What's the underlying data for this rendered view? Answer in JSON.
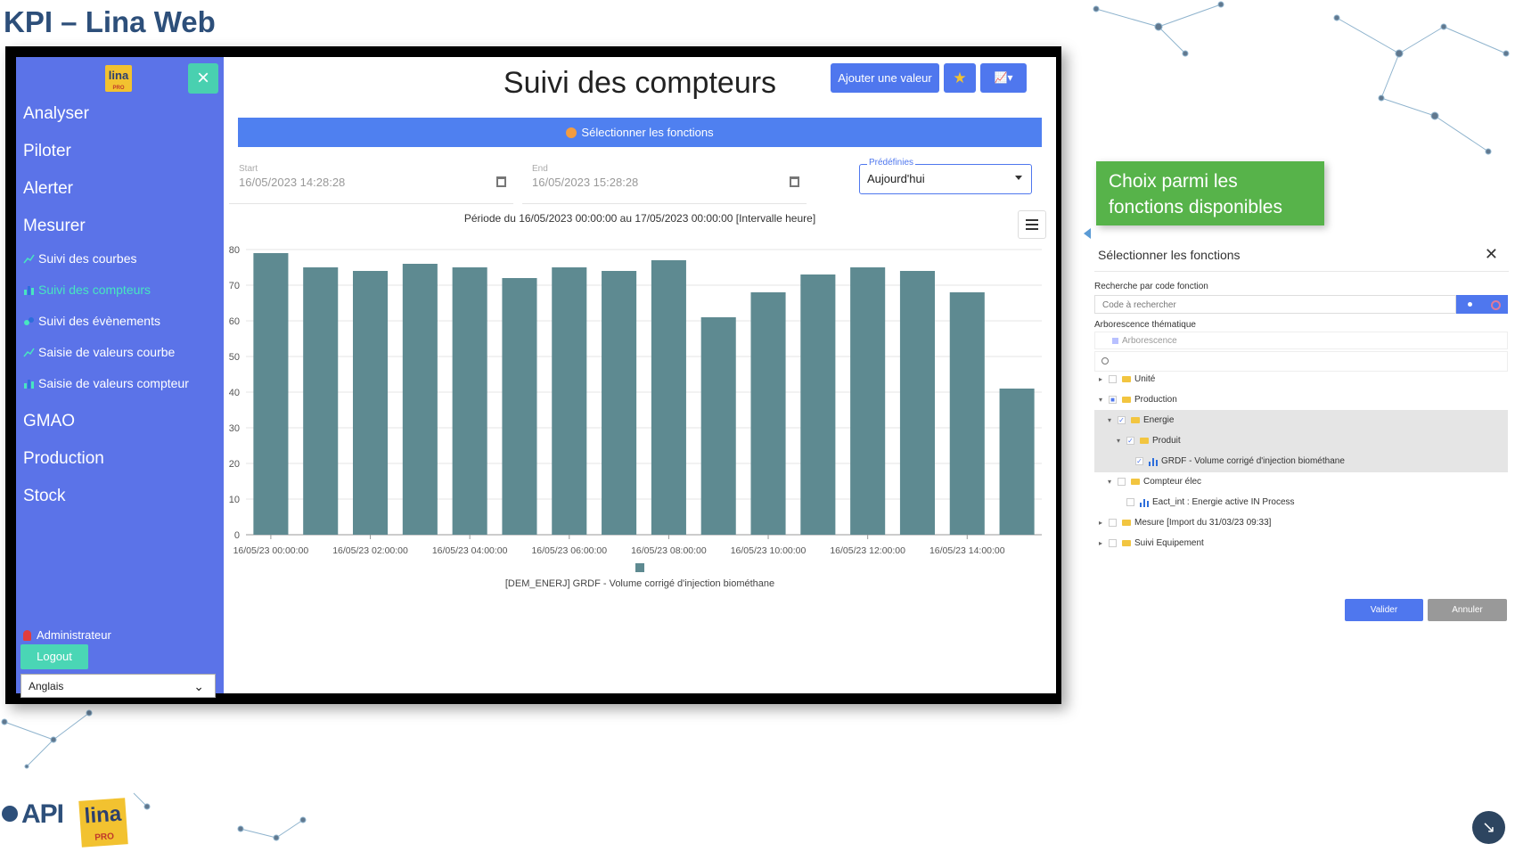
{
  "slide": {
    "title": "KPI – Lina Web"
  },
  "sidebar": {
    "logo_text": "lina",
    "logo_sub": "PRO",
    "close_icon": "×",
    "top_items": [
      {
        "label": "Analyser"
      },
      {
        "label": "Piloter"
      },
      {
        "label": "Alerter"
      },
      {
        "label": "Mesurer"
      }
    ],
    "sub_items": [
      {
        "label": "Suivi des courbes",
        "icon": "line-chart-icon"
      },
      {
        "label": "Suivi des compteurs",
        "icon": "bar-chart-icon",
        "active": true
      },
      {
        "label": "Suivi des évènements",
        "icon": "events-icon"
      },
      {
        "label": "Saisie de valeurs courbe",
        "icon": "line-chart-icon"
      },
      {
        "label": "Saisie de valeurs compteur",
        "icon": "bar-chart-icon"
      }
    ],
    "bottom_items": [
      {
        "label": "GMAO"
      },
      {
        "label": "Production"
      },
      {
        "label": "Stock"
      }
    ],
    "user": "Administrateur",
    "logout_label": "Logout",
    "language": "Anglais"
  },
  "main": {
    "title": "Suivi des compteurs",
    "add_value_label": "Ajouter une valeur",
    "select_functions_label": "Sélectionner les fonctions",
    "start": {
      "label": "Start",
      "value": "16/05/2023 14:28:28"
    },
    "end": {
      "label": "End",
      "value": "16/05/2023 15:28:28"
    },
    "predefined": {
      "label": "Prédéfinies",
      "value": "Aujourd'hui"
    },
    "period": "Période du 16/05/2023 00:00:00 au 17/05/2023 00:00:00  [Intervalle heure]"
  },
  "chart_data": {
    "type": "bar",
    "categories": [
      "16/05/23 00:00:00",
      "",
      "16/05/23 02:00:00",
      "",
      "16/05/23 04:00:00",
      "",
      "16/05/23 06:00:00",
      "",
      "16/05/23 08:00:00",
      "",
      "16/05/23 10:00:00",
      "",
      "16/05/23 12:00:00",
      "",
      "16/05/23 14:00:00",
      ""
    ],
    "x_tick_labels": [
      "16/05/23 00:00:00",
      "16/05/23 02:00:00",
      "16/05/23 04:00:00",
      "16/05/23 06:00:00",
      "16/05/23 08:00:00",
      "16/05/23 10:00:00",
      "16/05/23 12:00:00",
      "16/05/23 14:00:00"
    ],
    "series": [
      {
        "name": "[DEM_ENERJ] GRDF - Volume corrigé d'injection biométhane",
        "values": [
          79,
          75,
          74,
          76,
          75,
          72,
          75,
          74,
          77,
          61,
          68,
          73,
          75,
          74,
          68,
          41
        ]
      }
    ],
    "ylim": [
      0,
      80
    ],
    "yticks": [
      0,
      10,
      20,
      30,
      40,
      50,
      60,
      70,
      80
    ],
    "grid": true,
    "legend": "bottom",
    "bar_color": "#5e8a91"
  },
  "callout": {
    "line1": "Choix parmi les",
    "line2": "fonctions disponibles"
  },
  "dialog": {
    "title": "Sélectionner les fonctions",
    "search_label": "Recherche par code fonction",
    "search_placeholder": "Code à rechercher",
    "tree_label": "Arborescence thématique",
    "tree_root": "Arborescence",
    "tree": [
      {
        "label": "Unité",
        "caret": "▸",
        "check": ""
      },
      {
        "label": "Production",
        "caret": "▾",
        "check": "■"
      },
      {
        "label": "Energie",
        "caret": "▾",
        "check": "✓"
      },
      {
        "label": "Produit",
        "caret": "▾",
        "check": "✓"
      },
      {
        "label": "GRDF - Volume corrigé d'injection biométhane",
        "caret": "",
        "check": "✓"
      },
      {
        "label": "Compteur élec",
        "caret": "▾",
        "check": ""
      },
      {
        "label": "Eact_int : Energie active IN Process",
        "caret": "",
        "check": ""
      },
      {
        "label": "Mesure [Import du 31/03/23 09:33]",
        "caret": "▸",
        "check": ""
      },
      {
        "label": "Suivi Equipement",
        "caret": "▸",
        "check": ""
      }
    ],
    "validate_label": "Valider",
    "cancel_label": "Annuler"
  },
  "footer": {
    "api_logo": "API",
    "lina_logo": "lina",
    "lina_sub": "PRO",
    "corner_icon": "↘"
  }
}
